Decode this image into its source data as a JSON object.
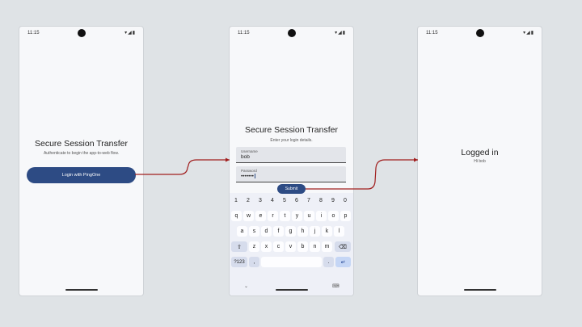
{
  "status": {
    "time": "11:15",
    "icons": "▾◢▮"
  },
  "screen1": {
    "title": "Secure Session Transfer",
    "subtitle": "Authenticate to begin the app-to-web flow.",
    "login_button": "Login with PingOne"
  },
  "screen2": {
    "title": "Secure Session Transfer",
    "subtitle": "Enter your login details.",
    "username_label": "Username",
    "username_value": "bob",
    "password_label": "Password",
    "password_value": "•••••••",
    "submit_label": "Submit"
  },
  "keyboard": {
    "numbers": [
      "1",
      "2",
      "3",
      "4",
      "5",
      "6",
      "7",
      "8",
      "9",
      "0"
    ],
    "row1": [
      "q",
      "w",
      "e",
      "r",
      "t",
      "y",
      "u",
      "i",
      "o",
      "p"
    ],
    "row2": [
      "a",
      "s",
      "d",
      "f",
      "g",
      "h",
      "j",
      "k",
      "l"
    ],
    "row3": [
      "z",
      "x",
      "c",
      "v",
      "b",
      "n",
      "m"
    ],
    "shift": "⇧",
    "backspace": "⌫",
    "symbols": "?123",
    "comma": ",",
    "period": ".",
    "enter": "↵",
    "nav_down": "⌄",
    "nav_keyboard": "⌨"
  },
  "screen3": {
    "title": "Logged in",
    "greeting": "Hi bob"
  },
  "colors": {
    "accent": "#2d4b84",
    "arrow": "#a01e1e"
  }
}
